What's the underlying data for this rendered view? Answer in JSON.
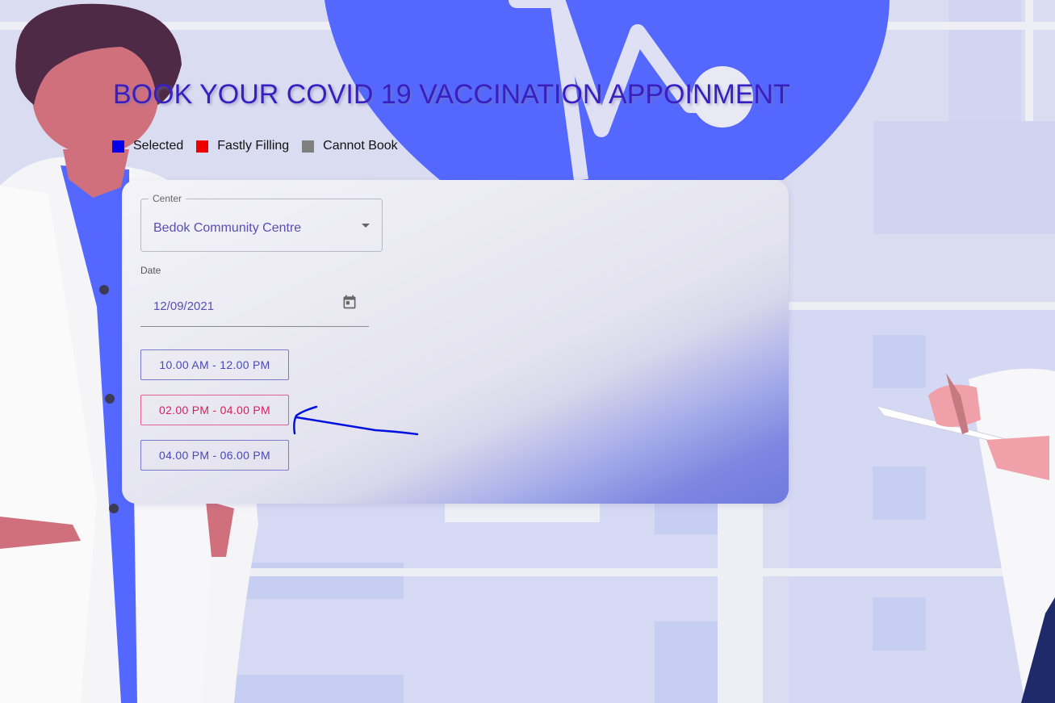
{
  "title": "BOOK YOUR COVID 19 VACCINATION APPOINMENT",
  "legend": [
    {
      "label": "Selected",
      "color": "#0000ee"
    },
    {
      "label": "Fastly Filling",
      "color": "#ee0000"
    },
    {
      "label": "Cannot Book",
      "color": "#808080"
    }
  ],
  "form": {
    "center_label": "Center",
    "center_value": "Bedok Community Centre",
    "date_label": "Date",
    "date_value": "12/09/2021",
    "slots": [
      {
        "label": "10.00 AM - 12.00 PM",
        "status": "available"
      },
      {
        "label": "02.00 PM - 04.00 PM",
        "status": "fastly-filling"
      },
      {
        "label": "04.00 PM - 06.00 PM",
        "status": "available"
      }
    ]
  },
  "icons": {
    "center_dropdown": "chevron-down-icon",
    "date_picker": "calendar-icon"
  },
  "colors": {
    "title": "#3a1fc0",
    "accent_blue": "#5468ff",
    "slot_border": "#7a7ad0",
    "slot_filling": "#d62060",
    "annotation": "#0010e0"
  }
}
